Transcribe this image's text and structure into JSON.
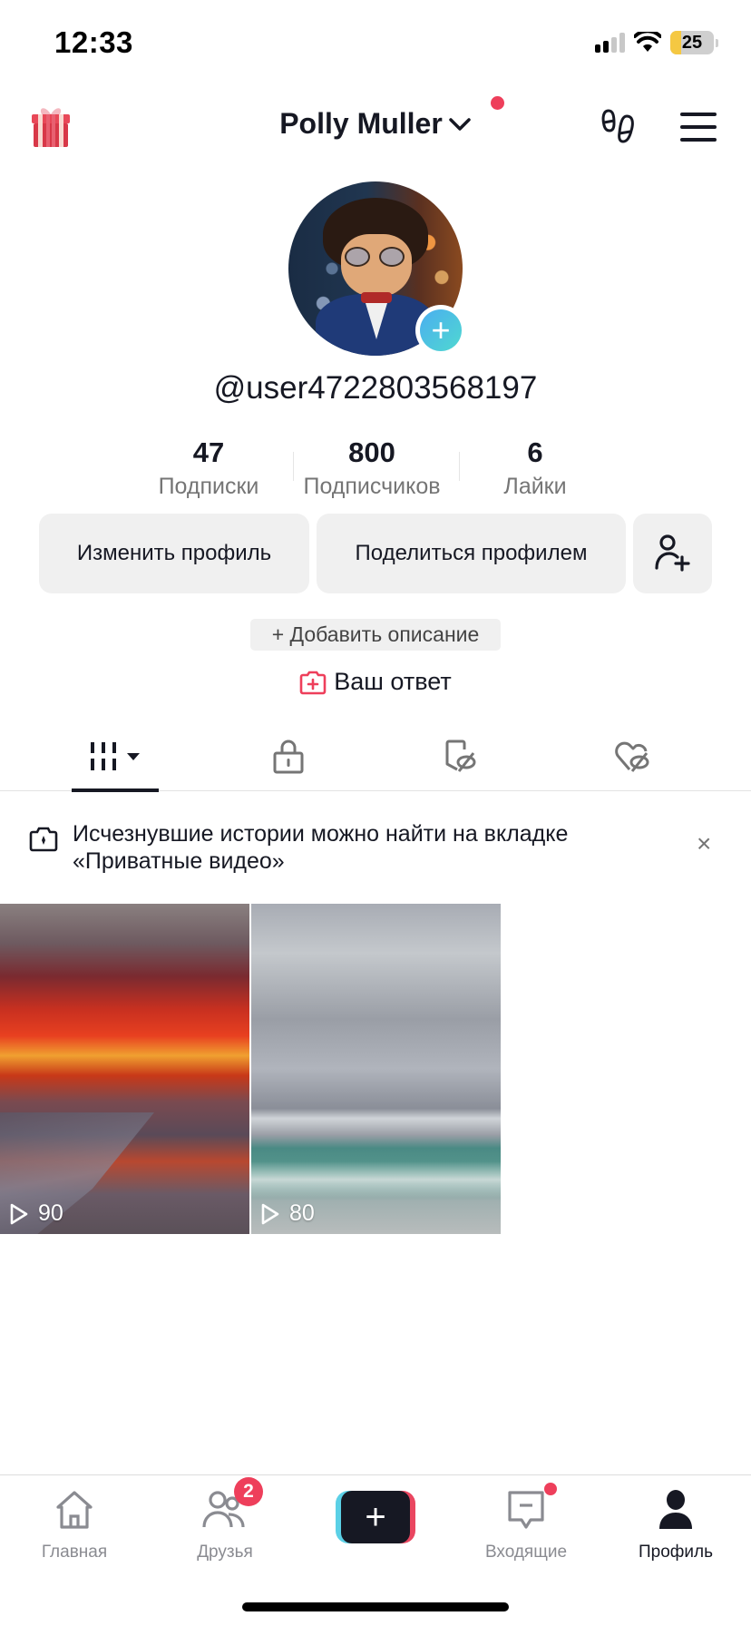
{
  "status_bar": {
    "time": "12:33",
    "battery_level": "25",
    "signal_bars_active": 2,
    "signal_bars_total": 4
  },
  "header": {
    "account_name": "Polly Muller",
    "has_notification_dot": true,
    "icons": [
      "gift-icon",
      "footprint-icon",
      "menu-icon"
    ]
  },
  "profile": {
    "username": "@user4722803568197",
    "avatar_add_symbol": "+"
  },
  "stats": [
    {
      "value": "47",
      "label": "Подписки"
    },
    {
      "value": "800",
      "label": "Подписчиков"
    },
    {
      "value": "6",
      "label": "Лайки"
    }
  ],
  "buttons": {
    "edit_profile": "Изменить профиль",
    "share_profile": "Поделиться профилем"
  },
  "add_description": "+ Добавить описание",
  "your_answer": "Ваш ответ",
  "tabs": [
    {
      "name": "videos",
      "icon": "grid-icon",
      "active": true
    },
    {
      "name": "private",
      "icon": "lock-icon",
      "active": false
    },
    {
      "name": "favorites",
      "icon": "bookmark-hidden-icon",
      "active": false
    },
    {
      "name": "liked",
      "icon": "heart-hidden-icon",
      "active": false
    }
  ],
  "notice": {
    "text": "Исчезнувшие истории можно найти на вкладке «Приватные видео»",
    "close_symbol": "×"
  },
  "videos": [
    {
      "views": "90",
      "description": "red sunset beach"
    },
    {
      "views": "80",
      "description": "cloudy sea beach"
    }
  ],
  "bottom_nav": {
    "items": [
      {
        "label": "Главная",
        "icon": "home-icon",
        "active": false
      },
      {
        "label": "Друзья",
        "icon": "friends-icon",
        "active": false,
        "badge": "2"
      },
      {
        "label": "",
        "icon": "create-icon",
        "active": false
      },
      {
        "label": "Входящие",
        "icon": "inbox-icon",
        "active": false,
        "dot": true
      },
      {
        "label": "Профиль",
        "icon": "profile-icon",
        "active": true
      }
    ],
    "create_symbol": "+"
  },
  "colors": {
    "accent_red": "#ee3f5b",
    "cyan": "#5bd0e6",
    "text_primary": "#161823",
    "text_secondary": "#757575",
    "button_bg": "#f0f0f0"
  }
}
